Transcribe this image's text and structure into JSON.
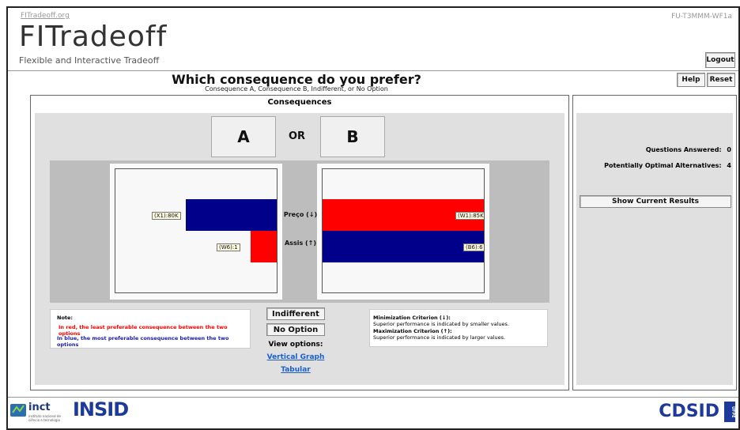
{
  "header": {
    "site_link": "FITradeoff.org",
    "case_code": "FU-T3MMM-WF1a",
    "logo_title": "FITradeoff",
    "logo_subtitle": "Flexible and Interactive Tradeoff",
    "logout_label": "Logout",
    "help_label": "Help",
    "reset_label": "Reset"
  },
  "question": {
    "title": "Which consequence do you prefer?",
    "subtitle": "Consequence A, Consequence B, Indifferent, or No Option"
  },
  "consequences": {
    "title": "Consequences",
    "option_a": "A",
    "or_label": "OR",
    "option_b": "B"
  },
  "chart_data": {
    "type": "bar",
    "criteria": [
      "Preço (↓)",
      "Assis (↑)"
    ],
    "consequence_a": [
      {
        "criterion": "Preço",
        "label": "(X1):80K",
        "color": "#00008b",
        "fraction_of_plot": 0.56
      },
      {
        "criterion": "Assis",
        "label": "(W6):1",
        "color": "#ff0000",
        "fraction_of_plot": 0.16
      }
    ],
    "consequence_b": [
      {
        "criterion": "Preço",
        "label": "(W1):85K",
        "color": "#ff0000",
        "fraction_of_plot": 1.0
      },
      {
        "criterion": "Assis",
        "label": "(B6):6",
        "color": "#00008b",
        "fraction_of_plot": 1.0
      }
    ]
  },
  "note": {
    "title": "Note:",
    "red_text": "In red, the least preferable consequence between the two options",
    "blue_text": "In blue, the most preferable consequence between the two options"
  },
  "actions": {
    "indifferent_label": "Indifferent",
    "no_option_label": "No Option",
    "view_options_label": "View options:",
    "vertical_graph_link": "Vertical Graph",
    "tabular_link": "Tabular"
  },
  "criteria_info": {
    "min_title": "Minimization Criterion (↓):",
    "min_text": "Superior performance is indicated by smaller values.",
    "max_title": "Maximization Criterion (↑):",
    "max_text": "Superior performance is indicated by larger values."
  },
  "sidebar": {
    "questions_answered_label": "Questions Answered:",
    "questions_answered_value": "0",
    "potentially_optimal_label": "Potentially Optimal Alternatives:",
    "potentially_optimal_value": "4",
    "show_results_label": "Show Current Results"
  },
  "footer": {
    "inct_label": "inct",
    "inct_sub": "instituto nacional de ciência e tecnologia",
    "insid_label": "INSID",
    "cdsid_label": "CDSID",
    "ufpe_label": "UFPE"
  },
  "colors": {
    "red": "#ff0000",
    "blue": "#00008b",
    "gray_panel": "#e0e0e0",
    "link": "#1a5fd0"
  }
}
